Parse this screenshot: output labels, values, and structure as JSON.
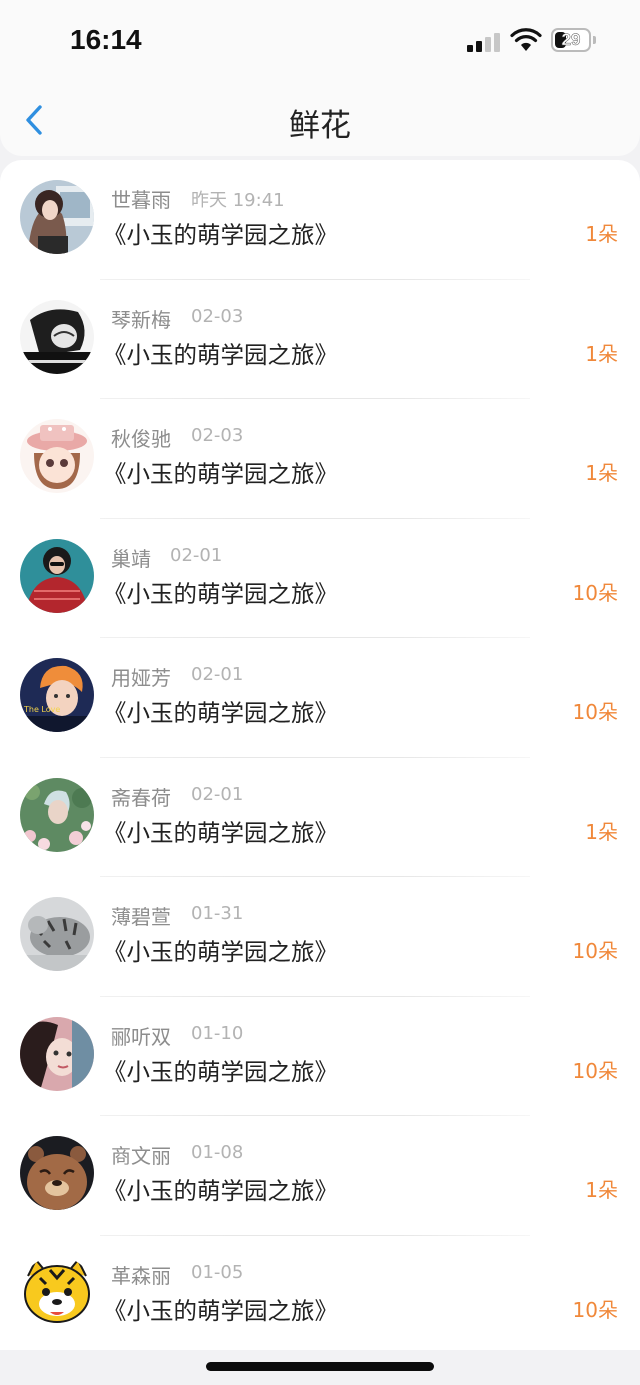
{
  "status_bar": {
    "time": "16:14",
    "battery": "29"
  },
  "nav": {
    "title": "鲜花"
  },
  "items": [
    {
      "sender": "世暮雨",
      "date": "昨天 19:41",
      "book": "《小玉的萌学园之旅》",
      "count": "1朵"
    },
    {
      "sender": "琴新梅",
      "date": "02-03",
      "book": "《小玉的萌学园之旅》",
      "count": "1朵"
    },
    {
      "sender": "秋俊驰",
      "date": "02-03",
      "book": "《小玉的萌学园之旅》",
      "count": "1朵"
    },
    {
      "sender": "巢靖",
      "date": "02-01",
      "book": "《小玉的萌学园之旅》",
      "count": "10朵"
    },
    {
      "sender": "用娅芳",
      "date": "02-01",
      "book": "《小玉的萌学园之旅》",
      "count": "10朵"
    },
    {
      "sender": "斋春荷",
      "date": "02-01",
      "book": "《小玉的萌学园之旅》",
      "count": "1朵"
    },
    {
      "sender": "薄碧萱",
      "date": "01-31",
      "book": "《小玉的萌学园之旅》",
      "count": "10朵"
    },
    {
      "sender": "郦听双",
      "date": "01-10",
      "book": "《小玉的萌学园之旅》",
      "count": "10朵"
    },
    {
      "sender": "商文丽",
      "date": "01-08",
      "book": "《小玉的萌学园之旅》",
      "count": "1朵"
    },
    {
      "sender": "革森丽",
      "date": "01-05",
      "book": "《小玉的萌学园之旅》",
      "count": "10朵"
    }
  ],
  "colors": {
    "accent": "#2f8fe0",
    "count": "#f0883a"
  }
}
